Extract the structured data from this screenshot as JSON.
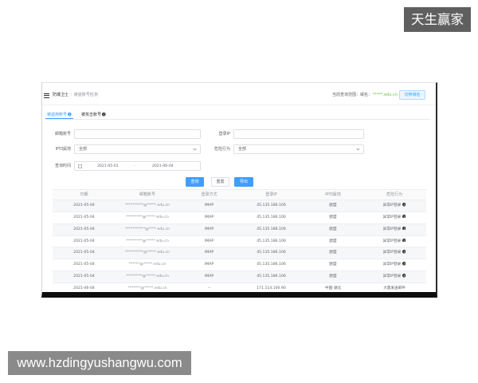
{
  "watermarks": {
    "top_right": "天生赢家",
    "bottom_left": "www.hzdingyushangwu.com"
  },
  "header": {
    "menu_icon": "menu-icon",
    "breadcrumb_root": "防爆卫士",
    "breadcrumb_sep": "/",
    "breadcrumb_current": "被盗账号检测",
    "scope_label": "当前查询范围：域名：",
    "scope_domain": "*****.edu.cn",
    "switch_button": "切换域名"
  },
  "tabs": [
    {
      "label": "被盗用账号",
      "active": true,
      "icon": "info-icon"
    },
    {
      "label": "被攻击账号",
      "active": false,
      "icon": "info-icon"
    }
  ],
  "filters": {
    "email": {
      "label": "邮箱账号",
      "value": ""
    },
    "login_ip": {
      "label": "登录IP",
      "value": ""
    },
    "ip_region": {
      "label": "IP归属地",
      "value": "全部",
      "icon": "chevron-down-icon"
    },
    "behavior": {
      "label": "危险行为",
      "value": "全部",
      "icon": "chevron-down-icon"
    },
    "time_range": {
      "label": "查询时间",
      "start": "2021-05-01",
      "separator": "-",
      "end": "2021-06-04",
      "icon": "calendar-icon"
    }
  },
  "actions": {
    "search": "查询",
    "reset": "重置",
    "export": "导出"
  },
  "table": {
    "striped": true,
    "columns": [
      "日期",
      "邮箱账号",
      "登录方式",
      "登录IP",
      "IP归属地",
      "危险行为"
    ],
    "rows": [
      {
        "date": "2021-05-04",
        "email": "**********@*****.edu.cn",
        "method": "IMAP",
        "ip": "45.135.186.106",
        "region": "欧盟",
        "behavior": "异常IP登录",
        "info_icon": true
      },
      {
        "date": "2021-05-04",
        "email": "*********@*****.edu.cn",
        "method": "IMAP",
        "ip": "45.135.186.106",
        "region": "欧盟",
        "behavior": "异常IP登录",
        "info_icon": true
      },
      {
        "date": "2021-05-04",
        "email": "***********@****.edu.cn",
        "method": "IMAP",
        "ip": "45.135.186.106",
        "region": "欧盟",
        "behavior": "异常IP登录",
        "info_icon": true
      },
      {
        "date": "2021-05-04",
        "email": "*********@*****.edu.cn",
        "method": "IMAP",
        "ip": "45.135.186.106",
        "region": "欧盟",
        "behavior": "异常IP登录",
        "info_icon": true
      },
      {
        "date": "2021-05-04",
        "email": "**********@*****.edu.cn",
        "method": "IMAP",
        "ip": "45.135.186.106",
        "region": "欧盟",
        "behavior": "异常IP登录",
        "info_icon": true
      },
      {
        "date": "2021-05-04",
        "email": "******@*****.edu.cn",
        "method": "IMAP",
        "ip": "45.135.186.106",
        "region": "欧盟",
        "behavior": "异常IP登录",
        "info_icon": true
      },
      {
        "date": "2021-05-04",
        "email": "*********@*****.edu.cn",
        "method": "IMAP",
        "ip": "45.135.186.106",
        "region": "欧盟",
        "behavior": "异常IP登录",
        "info_icon": true
      },
      {
        "date": "2021-06-04",
        "email": "*******@*****.edu.cn",
        "method": "--",
        "ip": "171.114.100.90",
        "region": "中国-湖北",
        "behavior": "大量发送邮件",
        "info_icon": false
      }
    ]
  },
  "colors": {
    "primary": "#409eff",
    "domain_text": "#67c23a",
    "text_primary": "#303133",
    "text_regular": "#606266",
    "text_secondary": "#909399",
    "border": "#dcdfe6",
    "stripe": "#f6f7f9",
    "watermark_top_bg": "#5f5f5f",
    "watermark_bottom_bg": "#8a8a8a"
  }
}
